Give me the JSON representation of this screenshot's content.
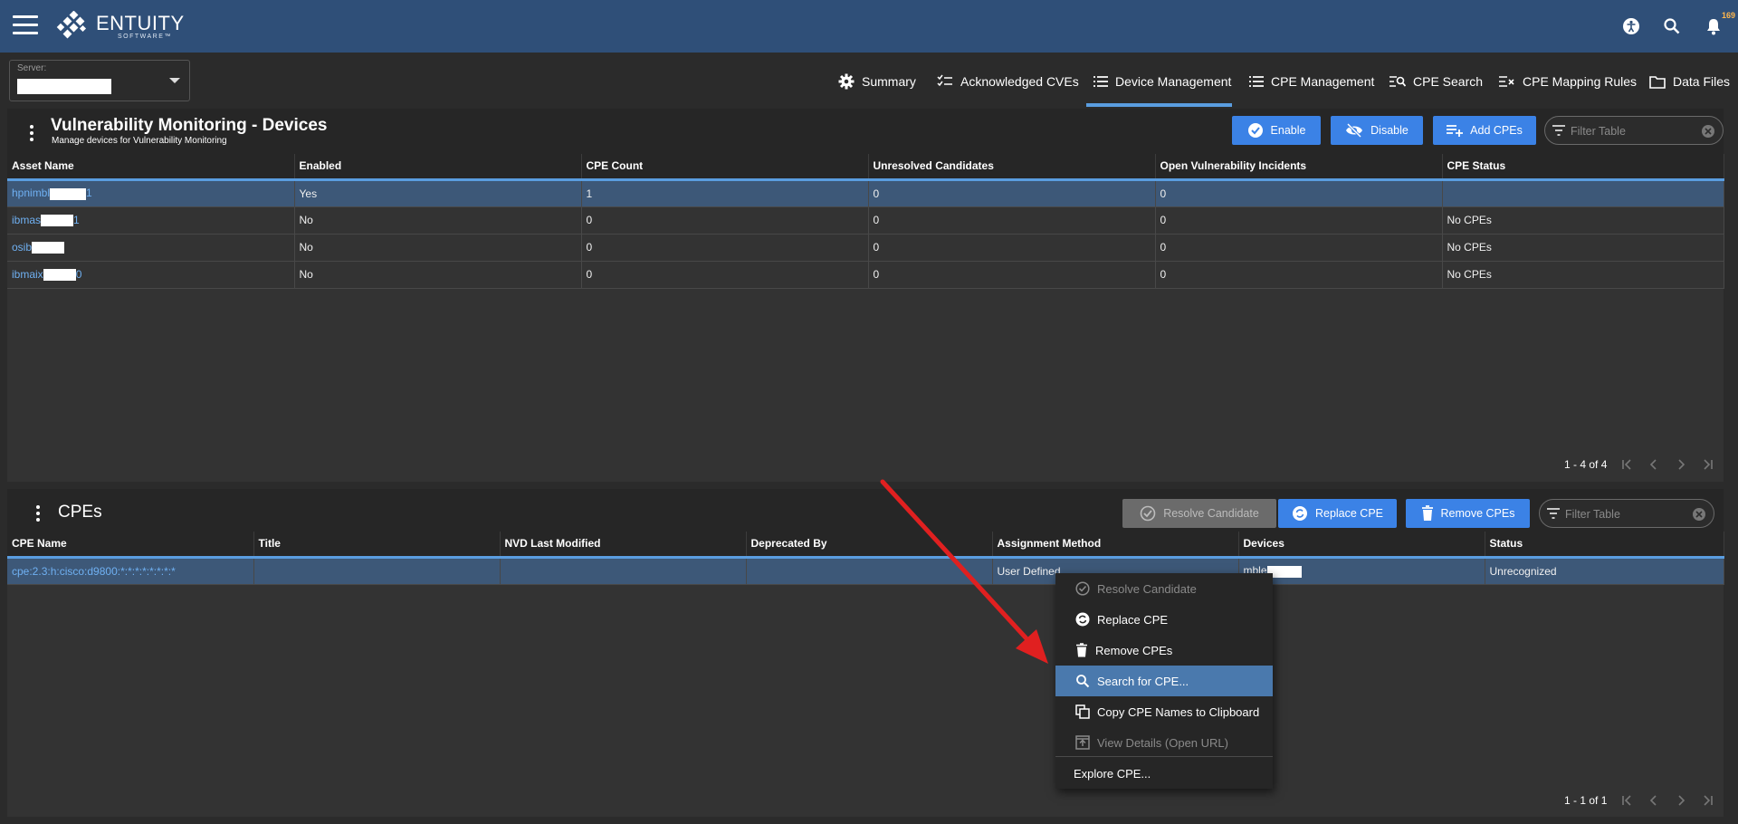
{
  "app": {
    "logo_main": "ENTUITY",
    "logo_sub": "SOFTWARE™",
    "notification_count": "169"
  },
  "server": {
    "label": "Server:"
  },
  "tabs": [
    {
      "label": "Summary",
      "icon": "gear-icon"
    },
    {
      "label": "Acknowledged CVEs",
      "icon": "checklist-icon"
    },
    {
      "label": "Device Management",
      "icon": "list-icon",
      "active": true
    },
    {
      "label": "CPE Management",
      "icon": "list-icon"
    },
    {
      "label": "CPE Search",
      "icon": "search-list-icon"
    },
    {
      "label": "CPE Mapping Rules",
      "icon": "mapping-icon"
    },
    {
      "label": "Data Files",
      "icon": "folder-icon"
    }
  ],
  "devices_panel": {
    "title": "Vulnerability Monitoring - Devices",
    "subtitle": "Manage devices for Vulnerability Monitoring",
    "buttons": {
      "enable": "Enable",
      "disable": "Disable",
      "add_cpes": "Add CPEs"
    },
    "filter_placeholder": "Filter Table",
    "columns": [
      "Asset Name",
      "Enabled",
      "CPE Count",
      "Unresolved Candidates",
      "Open Vulnerability Incidents",
      "CPE Status"
    ],
    "rows": [
      {
        "asset_prefix": "hpnimbl",
        "asset_suffix": "1",
        "enabled": "Yes",
        "cpe_count": "1",
        "unresolved": "0",
        "open_incidents": "0",
        "cpe_status": ""
      },
      {
        "asset_prefix": "ibmas",
        "asset_suffix": "1",
        "enabled": "No",
        "cpe_count": "0",
        "unresolved": "0",
        "open_incidents": "0",
        "cpe_status": "No CPEs"
      },
      {
        "asset_prefix": "osib",
        "asset_suffix": "",
        "enabled": "No",
        "cpe_count": "0",
        "unresolved": "0",
        "open_incidents": "0",
        "cpe_status": "No CPEs"
      },
      {
        "asset_prefix": "ibmaix",
        "asset_suffix": "0",
        "enabled": "No",
        "cpe_count": "0",
        "unresolved": "0",
        "open_incidents": "0",
        "cpe_status": "No CPEs"
      }
    ],
    "pager": "1 - 4 of 4"
  },
  "cpes_panel": {
    "title": "CPEs",
    "buttons": {
      "resolve_candidate": "Resolve Candidate",
      "replace_cpe": "Replace CPE",
      "remove_cpes": "Remove CPEs"
    },
    "filter_placeholder": "Filter Table",
    "columns": [
      "CPE Name",
      "Title",
      "NVD Last Modified",
      "Deprecated By",
      "Assignment Method",
      "Devices",
      "Status"
    ],
    "rows": [
      {
        "cpe_name": "cpe:2.3:h:cisco:d9800:*:*:*:*:*:*:*:*",
        "title": "",
        "nvd_last_modified": "",
        "deprecated_by": "",
        "assignment_method": "User Defined",
        "devices_prefix": "mble",
        "status": "Unrecognized"
      }
    ],
    "pager": "1 - 1 of 1"
  },
  "context_menu": {
    "items": [
      {
        "label": "Resolve Candidate",
        "icon": "check-circle-icon",
        "disabled": true
      },
      {
        "label": "Replace CPE",
        "icon": "replace-icon"
      },
      {
        "label": "Remove CPEs",
        "icon": "trash-icon"
      },
      {
        "label": "Search for CPE...",
        "icon": "search-icon",
        "highlighted": true
      },
      {
        "label": "Copy CPE Names to Clipboard",
        "icon": "copy-icon"
      },
      {
        "label": "View Details (Open URL)",
        "icon": "open-url-icon",
        "disabled": true
      },
      {
        "label": "Explore CPE..."
      }
    ]
  },
  "colors": {
    "topbar": "#2f4f78",
    "accent": "#3b82e6",
    "link": "#6fb0f2",
    "selected_row": "#3d5878",
    "arrow": "#e02020"
  }
}
